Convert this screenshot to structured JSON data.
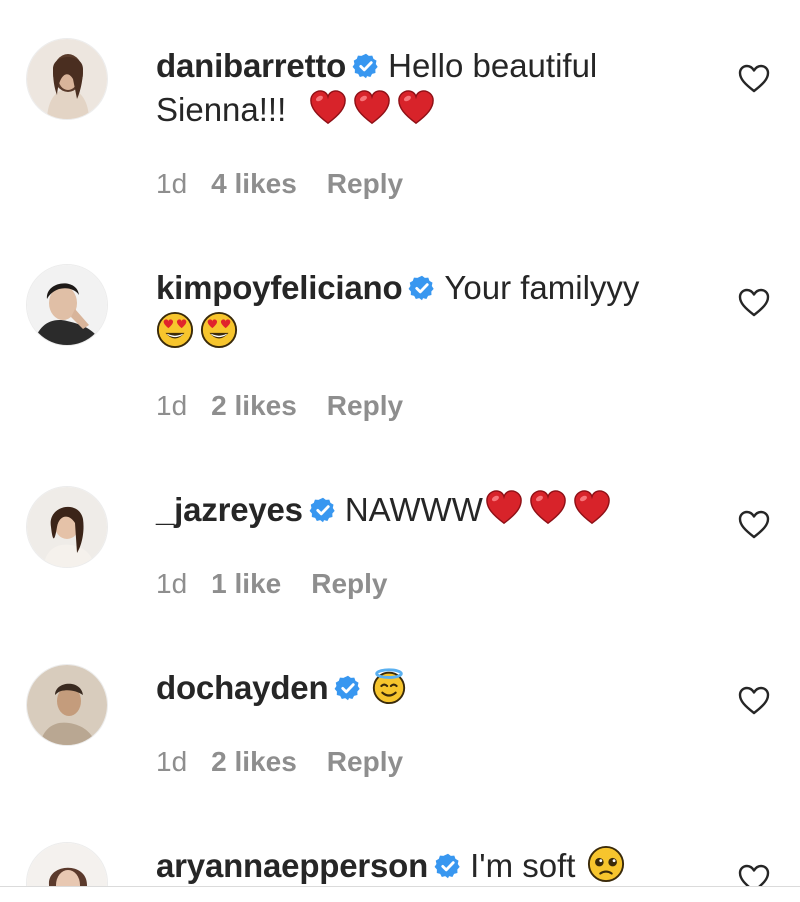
{
  "comments": [
    {
      "username": "danibarretto",
      "line1": "Hello beautiful",
      "line2": "Sienna!!!",
      "time": "1d",
      "likes": "4 likes",
      "reply": "Reply"
    },
    {
      "username": "kimpoyfeliciano",
      "line1": "Your familyyy",
      "line2": "",
      "time": "1d",
      "likes": "2 likes",
      "reply": "Reply"
    },
    {
      "username": "_jazreyes",
      "line1": "NAWWW",
      "line2": "",
      "time": "1d",
      "likes": "1 like",
      "reply": "Reply"
    },
    {
      "username": "dochayden",
      "line1": "",
      "line2": "",
      "time": "1d",
      "likes": "2 likes",
      "reply": "Reply"
    },
    {
      "username": "aryannaepperson",
      "line1": "I'm soft",
      "line2": "",
      "time": "",
      "likes": "",
      "reply": ""
    }
  ],
  "icons": {
    "verified": "verified-badge-icon",
    "like": "heart-outline-icon",
    "emoji_heart": "red-heart-emoji",
    "emoji_heart_eyes": "heart-eyes-emoji",
    "emoji_halo": "smiling-face-with-halo-emoji",
    "emoji_pleading": "frowning-face-emoji"
  },
  "colors": {
    "text": "#262626",
    "meta": "#8e8e8e",
    "verified": "#3897f0",
    "heart_emoji": "#d8232a"
  }
}
